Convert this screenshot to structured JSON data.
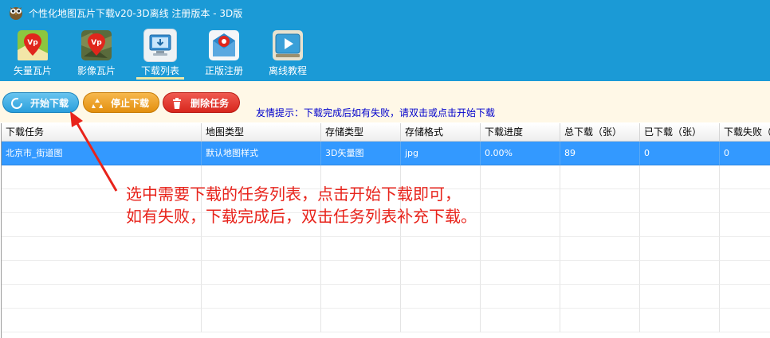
{
  "window": {
    "title": "个性化地图瓦片下载v20-3D离线  注册版本 - 3D版"
  },
  "ribbon": {
    "items": [
      {
        "label": "矢量瓦片",
        "icon": "vector-map-icon"
      },
      {
        "label": "影像瓦片",
        "icon": "satellite-map-icon"
      },
      {
        "label": "下载列表",
        "icon": "download-list-icon"
      },
      {
        "label": "正版注册",
        "icon": "register-icon"
      },
      {
        "label": "离线教程",
        "icon": "tutorial-icon"
      }
    ],
    "active_index": 2
  },
  "toolbar": {
    "start_label": "开始下载",
    "stop_label": "停止下载",
    "delete_label": "删除任务",
    "tip": "友情提示：下载完成后如有失败，请双击或点击开始下载"
  },
  "table": {
    "columns": [
      "下载任务",
      "地图类型",
      "存储类型",
      "存储格式",
      "下载进度",
      "总下载（张）",
      "已下载（张）",
      "下载失败（"
    ],
    "rows": [
      [
        "北京市_街道图",
        "默认地图样式",
        "3D矢量图",
        "jpg",
        "0.00%",
        "89",
        "0",
        "0"
      ]
    ],
    "selected_row": 0
  },
  "annotation": {
    "line1": "选中需要下载的任务列表，点击开始下载即可，",
    "line2": "如有失败，下载完成后，双击任务列表补充下载。"
  },
  "colors": {
    "titlebar": "#1b9ad6",
    "toolbar_bg": "#fff8e7",
    "selected_row": "#3399ff",
    "tip_text": "#0000cc",
    "annotation": "#e8231b"
  }
}
